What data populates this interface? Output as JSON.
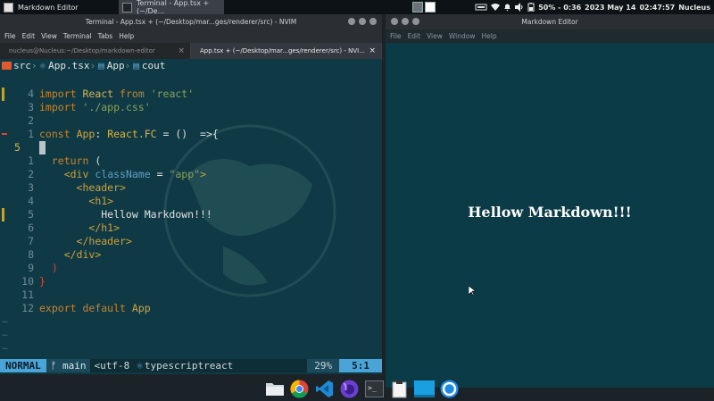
{
  "top_panel": {
    "tasks": [
      {
        "label": "Markdown Editor"
      },
      {
        "label": "Terminal - App.tsx + (~/De..."
      }
    ],
    "battery": "50% - 0:36",
    "date": "2023 May 14",
    "time": "02:47:57",
    "user": "Nucleus"
  },
  "terminal": {
    "title": "Terminal - App.tsx + (~/Desktop/mar...ges/renderer/src) - NVIM",
    "menu": [
      "File",
      "Edit",
      "View",
      "Terminal",
      "Tabs",
      "Help"
    ],
    "tabs": [
      {
        "label": "nucleus@Nucleus:~/Desktop/markdown-editor",
        "close": "×"
      },
      {
        "label": "App.tsx + (~/Desktop/mar...ges/renderer/src) - NVI...",
        "close": "×"
      }
    ],
    "winbar": {
      "folder": "src",
      "file": "App.tsx",
      "sym1": "App",
      "sym2": "cout"
    },
    "tilde": "~",
    "statusline": {
      "mode": "NORMAL",
      "branch": "main",
      "encoding": "<utf-8",
      "filetype": "typescriptreact",
      "percent": "29%",
      "position": "5:1"
    }
  },
  "md_editor": {
    "title": "Markdown Editor",
    "menu": [
      "File",
      "Edit",
      "View",
      "Window",
      "Help"
    ],
    "heading": "Hellow Markdown!!!"
  },
  "dock": {
    "items": [
      {
        "icon": "files-folder-icon"
      },
      {
        "icon": "chrome-icon"
      },
      {
        "icon": "vscode-icon"
      },
      {
        "icon": "firefox-icon"
      },
      {
        "icon": "terminal-icon"
      },
      {
        "icon": "clipboard-icon"
      },
      {
        "icon": "desktop-icon"
      },
      {
        "icon": "app-circle-icon"
      }
    ]
  },
  "colors": {
    "terminal_bg": "#0f3a45",
    "md_bg": "#0a3b46",
    "statusline_accent": "#4aa4d8"
  }
}
